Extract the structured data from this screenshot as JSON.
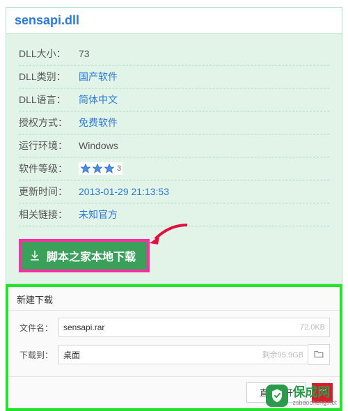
{
  "title": "sensapi.dll",
  "info": {
    "size_label": "DLL大小：",
    "size_value": "73",
    "cat_label": "DLL类别：",
    "cat_value": "国产软件",
    "lang_label": "DLL语言：",
    "lang_value": "简体中文",
    "lic_label": "授权方式：",
    "lic_value": "免费软件",
    "env_label": "运行环境：",
    "env_value": "Windows",
    "rank_label": "软件等级：",
    "rank_text": "3",
    "upd_label": "更新时间：",
    "upd_value": "2013-01-29 21:13:53",
    "rel_label": "相关链接：",
    "rel_value": "未知官方"
  },
  "download_button": "脚本之家本地下载",
  "dialog": {
    "title": "新建下载",
    "file_label": "文件名：",
    "file_value": "sensapi.rar",
    "file_size": "72.0KB",
    "dest_label": "下载到：",
    "dest_value": "桌面",
    "dest_hint": "剩余95.9GB",
    "open_button": "直接打开"
  },
  "watermark": {
    "cn": "保成网",
    "en": "zsbaocheng.net"
  }
}
